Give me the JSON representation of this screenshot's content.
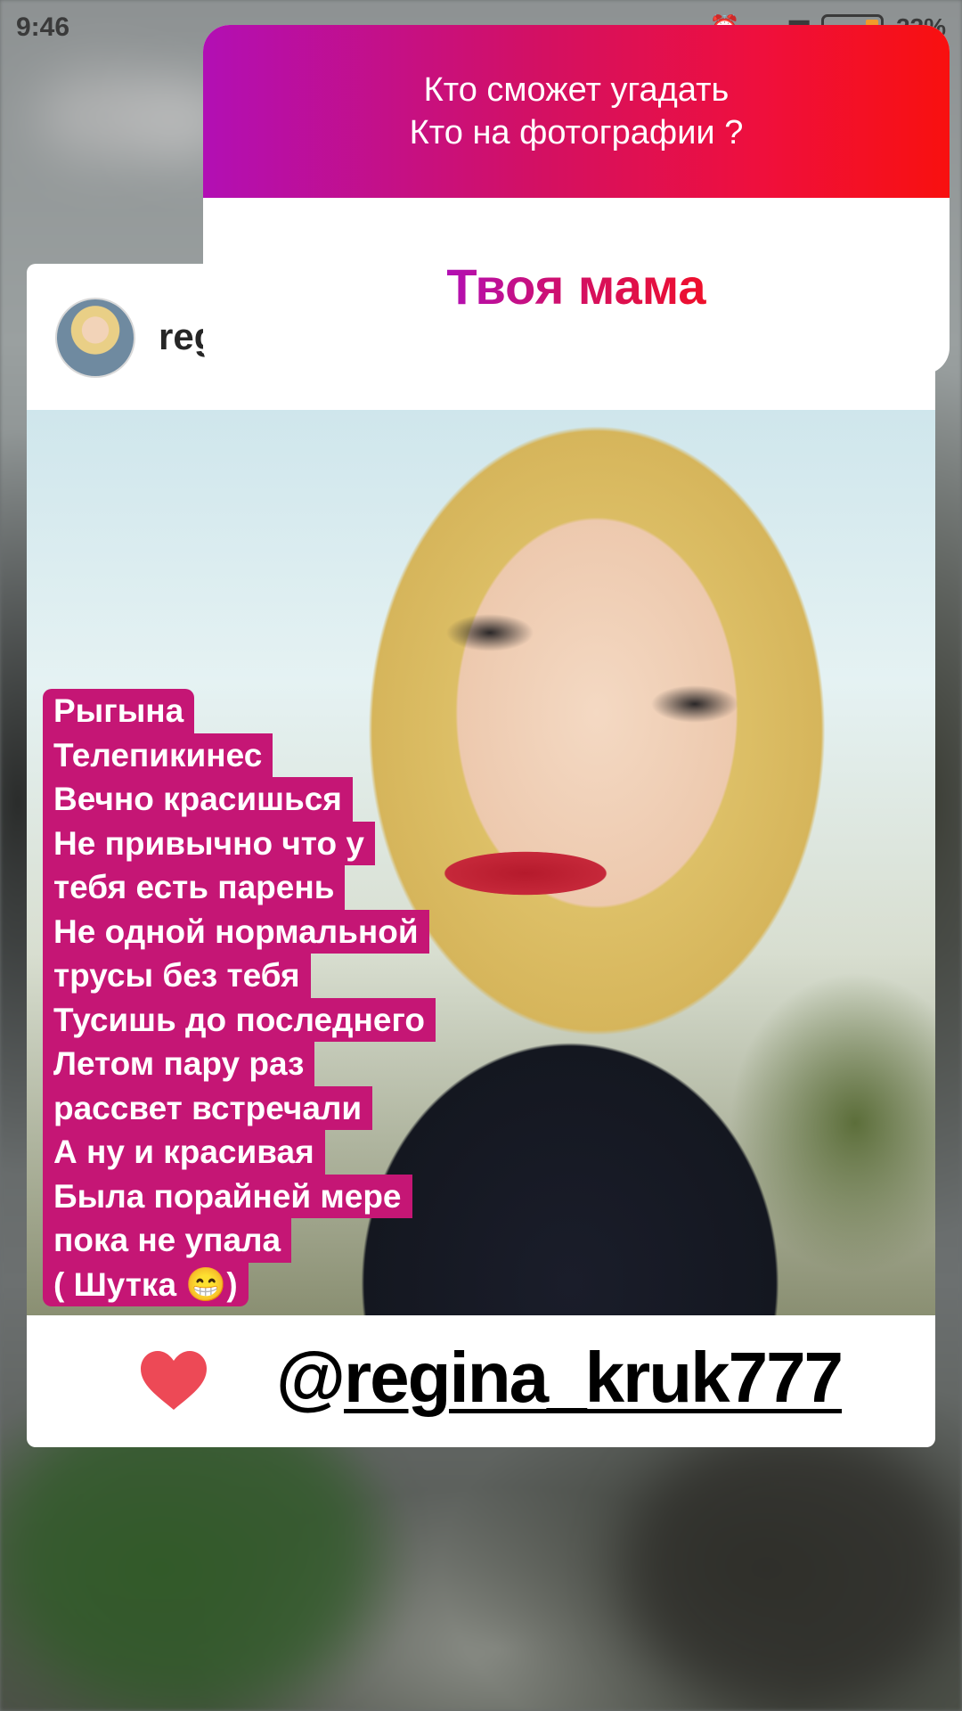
{
  "status_bar": {
    "time": "9:46",
    "battery": "22%"
  },
  "post": {
    "username": "reg",
    "caption_lines": [
      "Рыгына",
      "Телепикинес",
      "Вечно красишься",
      "Не привычно что у",
      "тебя есть парень",
      "Не одной нормальной",
      "трусы без тебя",
      "Тусишь до последнего",
      "Летом пару раз",
      "рассвет встречали",
      "А ну и красивая",
      "Была порайней мере",
      "пока не упала",
      "( Шутка 😁)"
    ],
    "mention_at": "@",
    "mention_name": "regina_kruk777"
  },
  "question_sticker": {
    "line1": "Кто сможет угадать",
    "line2": "Кто на фотографии ?",
    "answer": "Твоя мама"
  },
  "colors": {
    "caption_bg": "#c51675",
    "heart": "#ed4956",
    "gradient_start": "#b20fb4",
    "gradient_end": "#f8100f"
  },
  "icons": {
    "heart": "heart-icon",
    "battery": "battery-icon"
  }
}
